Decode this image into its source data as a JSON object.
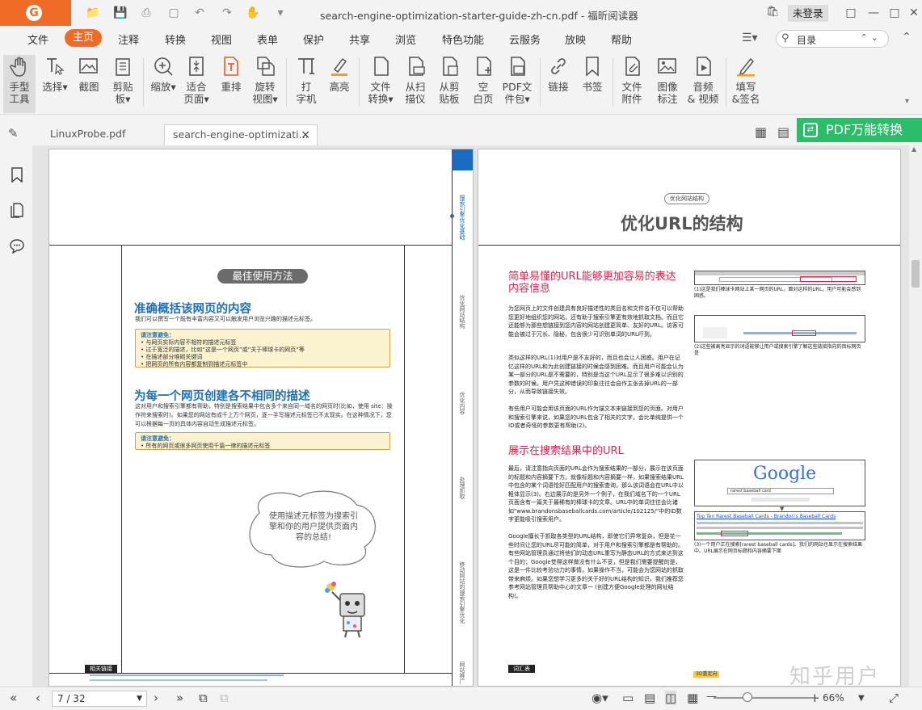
{
  "app": {
    "window_title": "search-engine-optimization-starter-guide-zh-cn.pdf - 福昕阅读器",
    "login_label": "未登录"
  },
  "menu": {
    "items": [
      "文件",
      "主页",
      "注释",
      "转换",
      "视图",
      "表单",
      "保护",
      "共享",
      "浏览",
      "特色功能",
      "云服务",
      "放映",
      "帮助"
    ],
    "active": "主页",
    "search_placeholder": "目录"
  },
  "ribbon": {
    "tools": [
      {
        "line1": "手型",
        "line2": "工具",
        "icon": "hand-icon"
      },
      {
        "line1": "选择",
        "line2": "",
        "icon": "select-text-icon"
      },
      {
        "line1": "截图",
        "line2": "",
        "icon": "snapshot-icon"
      },
      {
        "line1": "剪贴",
        "line2": "板",
        "icon": "clipboard-icon"
      },
      {
        "line1": "缩放",
        "line2": "",
        "icon": "zoom-icon"
      },
      {
        "line1": "适合",
        "line2": "页面",
        "icon": "fit-page-icon"
      },
      {
        "line1": "重排",
        "line2": "",
        "icon": "reflow-icon"
      },
      {
        "line1": "旋转",
        "line2": "视图",
        "icon": "rotate-icon"
      },
      {
        "line1": "打",
        "line2": "字机",
        "icon": "typewriter-icon"
      },
      {
        "line1": "高亮",
        "line2": "",
        "icon": "highlight-icon"
      },
      {
        "line1": "文件",
        "line2": "转换",
        "icon": "file-convert-icon"
      },
      {
        "line1": "从扫",
        "line2": "描仪",
        "icon": "scanner-icon"
      },
      {
        "line1": "从剪",
        "line2": "贴板",
        "icon": "from-clipboard-icon"
      },
      {
        "line1": "空",
        "line2": "白页",
        "icon": "blank-page-icon"
      },
      {
        "line1": "PDF文",
        "line2": "件包",
        "icon": "portfolio-icon"
      },
      {
        "line1": "链接",
        "line2": "",
        "icon": "link-icon"
      },
      {
        "line1": "书签",
        "line2": "",
        "icon": "bookmark-icon"
      },
      {
        "line1": "文件",
        "line2": "附件",
        "icon": "attachment-icon"
      },
      {
        "line1": "图像",
        "line2": "标注",
        "icon": "image-annotation-icon"
      },
      {
        "line1": "音频",
        "line2": "& 视频",
        "icon": "audio-video-icon"
      },
      {
        "line1": "填写",
        "line2": "&签名",
        "icon": "fill-sign-icon"
      }
    ]
  },
  "tabs": [
    {
      "label": "LinuxProbe.pdf"
    },
    {
      "label": "search-engine-optimizati...",
      "close": "×"
    }
  ],
  "pdf_convert_label": "PDF万能转换",
  "left_page": {
    "pill": "最佳使用方法",
    "h1": "准确概括该网页的内容",
    "p1": "我们可以撰写一个既有丰富内容又可以触发用户浏览兴趣的描述元标签。",
    "note1_title": "请注意避免：",
    "note1_items": [
      "与网页实际内容不相符的描述元标签",
      "过于宽泛的描述，比如“这是一个网页”或“关于棒球卡的网页”等",
      "在描述部分堆砌关键词",
      "把网页的所有内容都复制到描述元标签中"
    ],
    "h2": "为每一个网页创建各不相同的描述",
    "p2": "这对用户和搜索引擎都有帮助，特别是搜索结果中包含多个来自同一域名的网页时(比如，使用 site：操作符来搜索时)。如果您的网站有成千上万个网页，逐一手写描述元标签已不太现实。在这种情况下，您可以根据每一页的具体内容自动生成描述元标签。",
    "note2_title": "请注意避免：",
    "note2_items": [
      "所有的网页或很多网页使用千篇一律的描述元标签"
    ],
    "bubble": "使用描述元标签为搜索引擎和你的用户提供页面内容的总结!",
    "links_title": "相关链接",
    "side_labels": [
      "搜索引擎优化基础",
      "优化网站结构",
      "优化内容",
      "处理抓取",
      "移动网站的搜索引擎优化",
      "网站推广"
    ]
  },
  "right_page": {
    "section_pill": "优化网站结构",
    "title": "优化URL的结构",
    "h1": "简单易懂的URL能够更加容易的表达内容信息",
    "p1": "为您网页上的文件创建具有良好描述性的类目名和文件名不仅可以帮助您更好地组织您的网站，还有助于搜索引擎更有效地抓取文档。而且它还能够为那些想链接到您内容的网站创建更简单、友好的URL。访客可能会被过于冗长、隐秘，包含很少可识别单词的URL吓到。",
    "p2": "类似这样的URL(1)对用户是不友好的，而且也会让人困惑。用户在记忆这样的URL和为此创建链接的时候会感到困难。而且用户可能会认为某一部分的URL是不需要的，特别是当这个URL显示了很多难以识别的参数的时候。用户凭这种错误的印象往往会自作主张去掉URL的一部分，从而导致链接失效。",
    "p3": "有些用户可能会用该页面的URL作为锚文本来链接到您的页面。对用户和搜索引擎来说，如果您的URL包含了相关的文字，会比单纯提供一个ID或者奇怪的参数更有帮助(2)。",
    "h2": "展示在搜索结果中的URL",
    "p4": "最后，请注意指向页面的URL会作为搜索结果的一部分，展示在该页面的标题和内容摘要下方。就像标题和内容摘要一样，如果搜索结果URL中包含的某个词语恰好匹配用户的搜索查询，那么该词语会在URL中以粗体显示(3)。右边展示的是另外一个例子，在我们域名下的一个URL页面含有一篇关于最稀有的棒球卡的文章。URL中的单词往往会比诸如\"www.brandonsbaseballcards.com/article/102125/\"中的ID数字更能吸引搜索用户。",
    "p5": "Google擅长于抓取各类型的URL结构，即使它们异常复杂，但是花一些时间让您的URL尽可能的简单，对于用户和搜索引擎都是有帮助的。有些网站管理员通过将他们的动态URL重写为静态URL的方式来达到这个目的；Google觉得这样做没有什么不妥，但是我们需要提醒的是，这是一件比较考验功力的事情，如果操作不当，可能会为您网站的抓取带来麻烦。如果您想学习更多的关于好的URL结构的知识，我们推荐您参考网站管理员帮助中心的文章一 (创建方便Google处理的网址结构)。",
    "cap1": "(1)这是我们棒球卡网站上某一网页的URL，面对这样的URL，用户可能会感到困惑。",
    "cap2": "(2)这些被高亮显示的词语能够让用户或搜索引擎了解这些链接指向的目标网页是",
    "cap3": "(3)一个用户正在搜索[rarest baseball cards]。我们的网站也显示在搜索结果中。URL展示在网页标题和内容摘要下面",
    "google_logo": "Google",
    "google_query": "rarest baseball card",
    "result_title": "Top Ten Rarest Baseball Cards - Brandon's Baseball Cards",
    "footer_label": "词汇表",
    "footer_sub": "3D重定向",
    "watermark": "知乎用户"
  },
  "statusbar": {
    "page_value": "7 / 32",
    "zoom": "66%"
  }
}
